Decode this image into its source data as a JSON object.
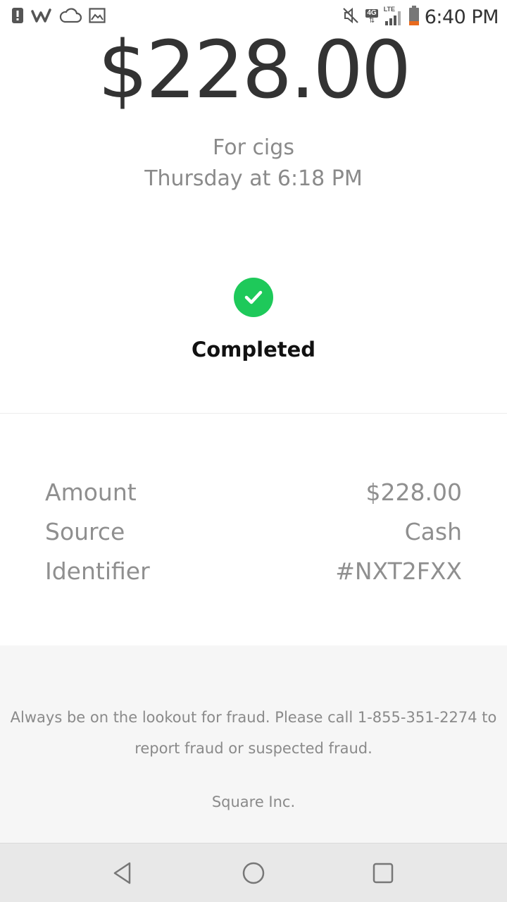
{
  "status_bar": {
    "time": "6:40 PM",
    "network": "4G",
    "lte": "LTE",
    "icons": [
      "alert-icon",
      "wish-icon",
      "cloud-icon",
      "image-icon",
      "mute-icon",
      "signal-icon",
      "battery-icon"
    ],
    "battery_color": "#e86a1e"
  },
  "payment": {
    "amount": "$228.00",
    "memo": "For cigs",
    "date": "Thursday at 6:18 PM",
    "status": "Completed",
    "status_color": "#1ec95a"
  },
  "details": [
    {
      "label": "Amount",
      "value": "$228.00"
    },
    {
      "label": "Source",
      "value": "Cash"
    },
    {
      "label": "Identifier",
      "value": "#NXT2FXX"
    }
  ],
  "footer": {
    "line1": "Always be on the lookout for fraud. Please call 1-855-351-2274 to",
    "line2": "report fraud or suspected fraud.",
    "company": "Square Inc."
  },
  "nav": {
    "icons": [
      "back-icon",
      "home-icon",
      "recents-icon"
    ]
  }
}
